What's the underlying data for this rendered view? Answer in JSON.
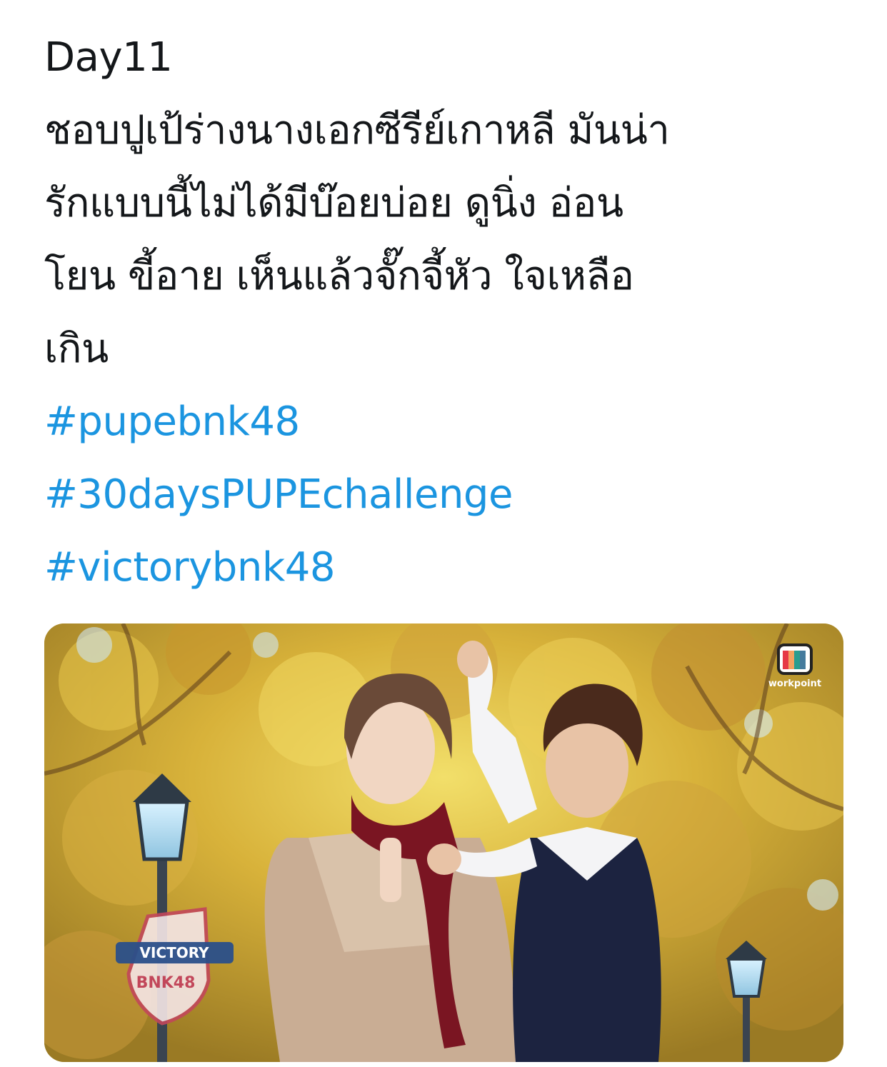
{
  "tweet": {
    "lines": [
      "Day11",
      "ชอบปูเป้ร่างนางเอกซีรีย์เกาหลี มันน่า",
      "รักแบบนี้ไม่ได้มีบ๊อยบ่อย ดูนิ่ง อ่อน",
      "โยน ขี้อาย เห็นแล้วจั๊กจี้หัว ใจเหลือ",
      "เกิน"
    ],
    "hashtags": [
      "#pupebnk48",
      "#30daysPUPEchallenge",
      "#victorybnk48"
    ]
  },
  "media": {
    "channel_logo_label": "workpoint",
    "show_badge_top": "VICTORY",
    "show_badge_bottom": "BNK48"
  },
  "colors": {
    "hashtag": "#1b95e0",
    "text": "#14171a",
    "background": "#ffffff"
  }
}
